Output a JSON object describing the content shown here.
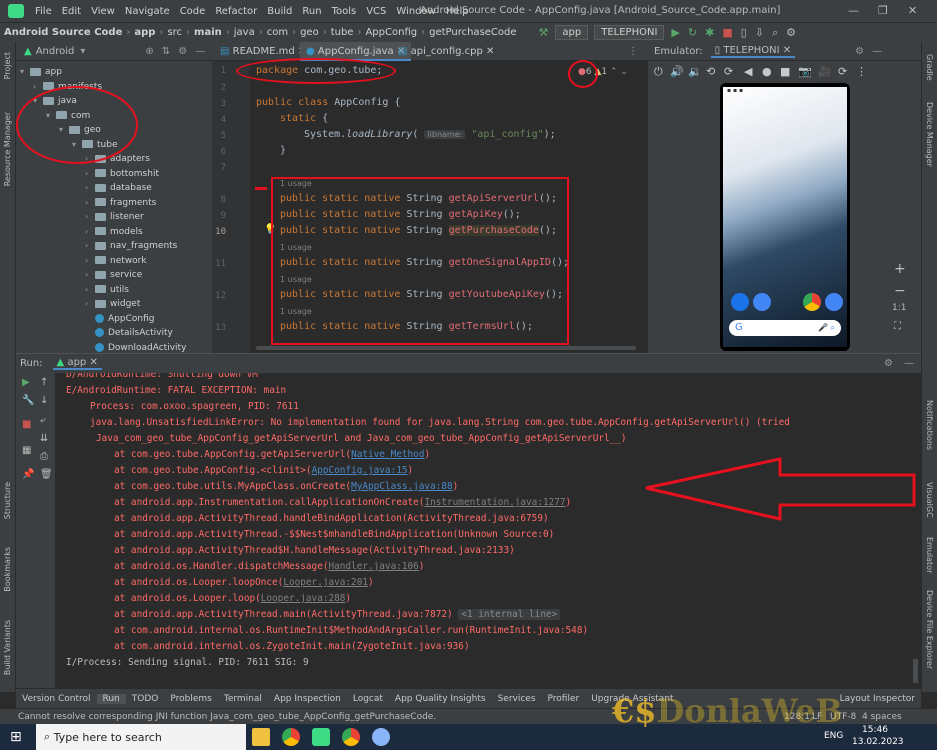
{
  "menu": {
    "items": [
      "File",
      "Edit",
      "View",
      "Navigate",
      "Code",
      "Refactor",
      "Build",
      "Run",
      "Tools",
      "VCS",
      "Window",
      "Help"
    ],
    "window_title": "Android Source Code - AppConfig.java [Android_Source_Code.app.main]",
    "minimize": "—",
    "restore": "❐",
    "close": "✕"
  },
  "nav": {
    "crumbs": [
      "Android Source Code",
      "app",
      "src",
      "main",
      "java",
      "com",
      "geo",
      "tube",
      "AppConfig",
      "getPurchaseCode"
    ],
    "run_config": "app",
    "device": "TELEPHONI"
  },
  "left_strip": {
    "project": "Project",
    "resource_manager": "Resource Manager",
    "structure": "Structure",
    "bookmarks": "Bookmarks",
    "build_variants": "Build Variants"
  },
  "right_strip": {
    "gradle": "Gradle",
    "device_manager": "Device Manager",
    "notifications": "Notifications",
    "visualgc": "VisualGC",
    "emulator": "Emulator",
    "device_file_explorer": "Device File Explorer"
  },
  "project_panel": {
    "view": "Android",
    "tree": [
      {
        "label": "app",
        "indent": 0,
        "arrow": "▾",
        "type": "folder"
      },
      {
        "label": "manifests",
        "indent": 1,
        "arrow": "›",
        "type": "folder"
      },
      {
        "label": "java",
        "indent": 1,
        "arrow": "▾",
        "type": "folder"
      },
      {
        "label": "com",
        "indent": 2,
        "arrow": "▾",
        "type": "folder"
      },
      {
        "label": "geo",
        "indent": 3,
        "arrow": "▾",
        "type": "folder"
      },
      {
        "label": "tube",
        "indent": 4,
        "arrow": "▾",
        "type": "folder"
      },
      {
        "label": "adapters",
        "indent": 5,
        "arrow": "›",
        "type": "folder"
      },
      {
        "label": "bottomshit",
        "indent": 5,
        "arrow": "›",
        "type": "folder"
      },
      {
        "label": "database",
        "indent": 5,
        "arrow": "›",
        "type": "folder"
      },
      {
        "label": "fragments",
        "indent": 5,
        "arrow": "›",
        "type": "folder"
      },
      {
        "label": "listener",
        "indent": 5,
        "arrow": "›",
        "type": "folder"
      },
      {
        "label": "models",
        "indent": 5,
        "arrow": "›",
        "type": "folder"
      },
      {
        "label": "nav_fragments",
        "indent": 5,
        "arrow": "›",
        "type": "folder"
      },
      {
        "label": "network",
        "indent": 5,
        "arrow": "›",
        "type": "folder"
      },
      {
        "label": "service",
        "indent": 5,
        "arrow": "›",
        "type": "folder"
      },
      {
        "label": "utils",
        "indent": 5,
        "arrow": "›",
        "type": "folder"
      },
      {
        "label": "widget",
        "indent": 5,
        "arrow": "›",
        "type": "folder"
      },
      {
        "label": "AppConfig",
        "indent": 5,
        "arrow": "",
        "type": "class"
      },
      {
        "label": "DetailsActivity",
        "indent": 5,
        "arrow": "",
        "type": "class"
      },
      {
        "label": "DownloadActivity",
        "indent": 5,
        "arrow": "",
        "type": "class"
      }
    ]
  },
  "editor_tabs": [
    "README.md",
    "AppConfig.java",
    "api_config.cpp"
  ],
  "editor": {
    "inspection_errors": "6",
    "inspection_warnings": "1",
    "param_hint": "libname:",
    "usage_label": "1 usage"
  },
  "emulator": {
    "title": "Emulator:",
    "device": "TELEPHONI",
    "zoom": "1:1",
    "zoom_in": "+"
  },
  "run_panel": {
    "label": "Run:",
    "config": "app"
  },
  "bottom_tabs": [
    "Version Control",
    "Run",
    "TODO",
    "Problems",
    "Terminal",
    "App Inspection",
    "Logcat",
    "App Quality Insights",
    "Services",
    "Profiler",
    "Upgrade Assistant",
    "Layout Inspector"
  ],
  "status": {
    "message": "Cannot resolve corresponding JNI function Java_com_geo_tube_AppConfig_getPurchaseCode.",
    "position": "128:1",
    "lf": "LF",
    "encoding": "UTF-8",
    "indent": "4 spaces"
  },
  "taskbar": {
    "search_placeholder": "Type here to search",
    "time": "15:46",
    "date": "13.02.2023",
    "lang": "ENG"
  },
  "watermark": "DonlaWeB"
}
